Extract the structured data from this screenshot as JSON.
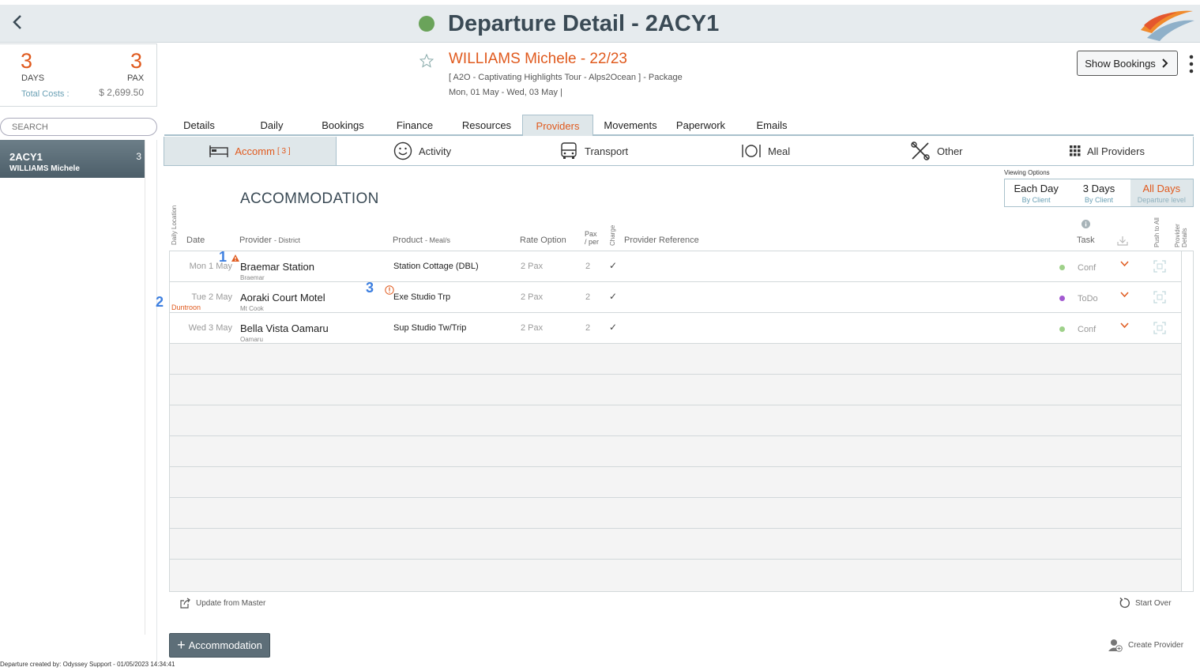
{
  "header": {
    "title": "Departure Detail - 2ACY1",
    "status_color": "#6aa35a"
  },
  "summary": {
    "days": "3",
    "days_label": "DAYS",
    "pax": "3",
    "pax_label": "PAX",
    "total_costs_label": "Total Costs :",
    "total_costs": "$ 2,699.50"
  },
  "search": {
    "placeholder": "SEARCH"
  },
  "departure_card": {
    "code": "2ACY1",
    "name": "WILLIAMS Michele",
    "count": "3"
  },
  "footer_note": "Departure created by: Odyssey Support - 01/05/2023 14:34:41",
  "client": {
    "name": "WILLIAMS Michele - 22/23",
    "tour": "[ A2O - Captivating Highlights Tour - Alps2Ocean ] - Package",
    "dates": "Mon, 01 May  - Wed, 03 May  |"
  },
  "show_bookings": "Show Bookings",
  "tabs": [
    {
      "label": "Details"
    },
    {
      "label": "Daily"
    },
    {
      "label": "Bookings"
    },
    {
      "label": "Finance"
    },
    {
      "label": "Resources"
    },
    {
      "label": "Providers"
    },
    {
      "label": "Movements"
    },
    {
      "label": "Paperwork"
    },
    {
      "label": "Emails"
    }
  ],
  "subtabs": {
    "accom": "Accomm",
    "accom_count": "[ 3 ]",
    "activity": "Activity",
    "transport": "Transport",
    "meal": "Meal",
    "other": "Other",
    "all": "All Providers"
  },
  "viewing_options": {
    "label": "Viewing Options",
    "each_day": "Each Day",
    "each_day_sub": "By Client",
    "three_days": "3 Days",
    "three_days_sub": "By Client",
    "all_days": "All Days",
    "all_days_sub": "Departure level"
  },
  "section_title": "ACCOMMODATION",
  "columns": {
    "daily_location": "Daily Location",
    "date": "Date",
    "provider": "Provider",
    "district": "- District",
    "product": "Product",
    "meals": "- Meal/s",
    "rate_option": "Rate Option",
    "pax": "Pax",
    "per": "/ per",
    "charge": "Charge",
    "provider_reference": "Provider Reference",
    "task": "Task",
    "push_to_all": "Push to All",
    "provider_details": "Provider Details"
  },
  "rows": [
    {
      "date": "Mon 1 May",
      "provider": "Braemar Station",
      "district": "Braemar",
      "product": "Station Cottage (DBL)",
      "rate": "2 Pax",
      "pax": "2",
      "charge": "✓",
      "task": "Conf",
      "task_color": "#9fd18a",
      "location": ""
    },
    {
      "date": "Tue 2 May",
      "provider": "Aoraki Court Motel",
      "district": "Mt Cook",
      "product": "Exe Studio Trp",
      "rate": "2 Pax",
      "pax": "2",
      "charge": "✓",
      "task": "ToDo",
      "task_color": "#a35ad1",
      "location": "Duntroon"
    },
    {
      "date": "Wed 3 May",
      "provider": "Bella Vista Oamaru",
      "district": "Oamaru",
      "product": "Sup Studio Tw/Trip",
      "rate": "2 Pax",
      "pax": "2",
      "charge": "✓",
      "task": "Conf",
      "task_color": "#9fd18a",
      "location": ""
    }
  ],
  "annotations": {
    "one": "1",
    "two": "2",
    "three": "3"
  },
  "actions": {
    "update_master": "Update from Master",
    "start_over": "Start Over",
    "add_accommodation": "Accommodation",
    "create_provider": "Create Provider"
  },
  "colors": {
    "accent": "#e05a1e",
    "tab_border": "#a9c1cc",
    "button": "#5d6e78"
  }
}
